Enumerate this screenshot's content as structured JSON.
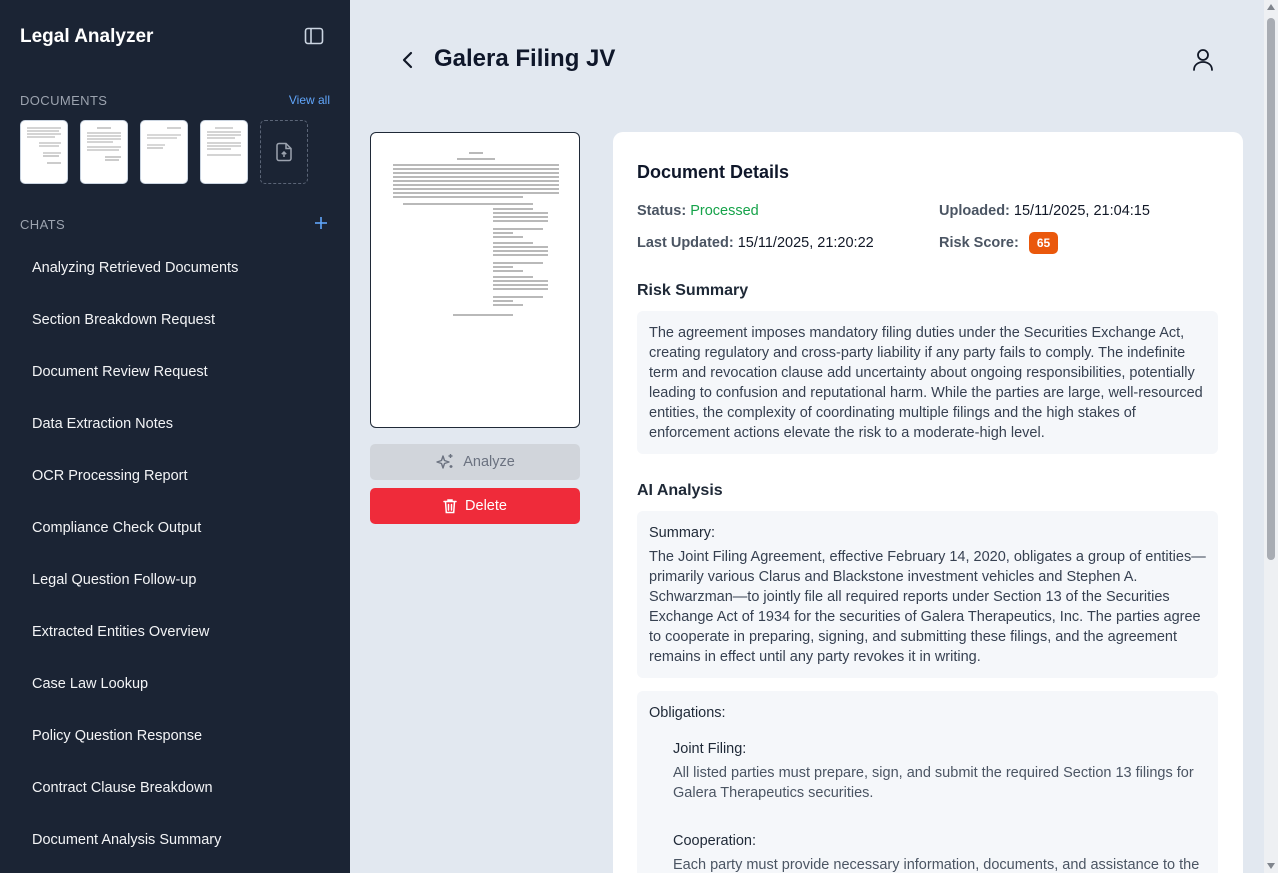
{
  "app": {
    "title": "Legal Analyzer"
  },
  "sidebar": {
    "documents_label": "DOCUMENTS",
    "view_all_label": "View all",
    "chats_label": "CHATS",
    "chats": [
      "Analyzing Retrieved Documents",
      "Section Breakdown Request",
      "Document Review Request",
      "Data Extraction Notes",
      "OCR Processing Report",
      "Compliance Check Output",
      "Legal Question Follow-up",
      "Extracted Entities Overview",
      "Case Law Lookup",
      "Policy Question Response",
      "Contract Clause Breakdown",
      "Document Analysis Summary"
    ]
  },
  "header": {
    "title": "Galera Filing JV"
  },
  "actions": {
    "analyze_label": "Analyze",
    "delete_label": "Delete"
  },
  "details": {
    "title": "Document Details",
    "status_label": "Status:",
    "status_value": "Processed",
    "uploaded_label": "Uploaded:",
    "uploaded_value": "15/11/2025, 21:04:15",
    "updated_label": "Last Updated:",
    "updated_value": "15/11/2025, 21:20:22",
    "risk_label": "Risk Score:",
    "risk_value": "65",
    "risk_summary_title": "Risk Summary",
    "risk_summary_text": "The agreement imposes mandatory filing duties under the Securities Exchange Act, creating regulatory and cross-party liability if any party fails to comply. The indefinite term and revocation clause add uncertainty about ongoing responsibilities, potentially leading to confusion and reputational harm. While the parties are large, well-resourced entities, the complexity of coordinating multiple filings and the high stakes of enforcement actions elevate the risk to a moderate-high level.",
    "ai_title": "AI Analysis",
    "summary_label": "Summary:",
    "summary_text": "The Joint Filing Agreement, effective February 14, 2020, obligates a group of entities—primarily various Clarus and Blackstone investment vehicles and Stephen A. Schwarzman—to jointly file all required reports under Section 13 of the Securities Exchange Act of 1934 for the securities of Galera Therapeutics, Inc. The parties agree to cooperate in preparing, signing, and submitting these filings, and the agreement remains in effect until any party revokes it in writing.",
    "obligations_label": "Obligations:",
    "obligations": [
      {
        "title": "Joint Filing:",
        "text": "All listed parties must prepare, sign, and submit the required Section 13 filings for Galera Therapeutics securities."
      },
      {
        "title": "Cooperation:",
        "text": "Each party must provide necessary information, documents, and assistance to the"
      }
    ]
  },
  "colors": {
    "sidebar_bg": "#1b2434",
    "accent_blue": "#60a5fa",
    "status_green": "#16a34a",
    "risk_orange": "#ea580c",
    "delete_red": "#ef2b3a"
  }
}
